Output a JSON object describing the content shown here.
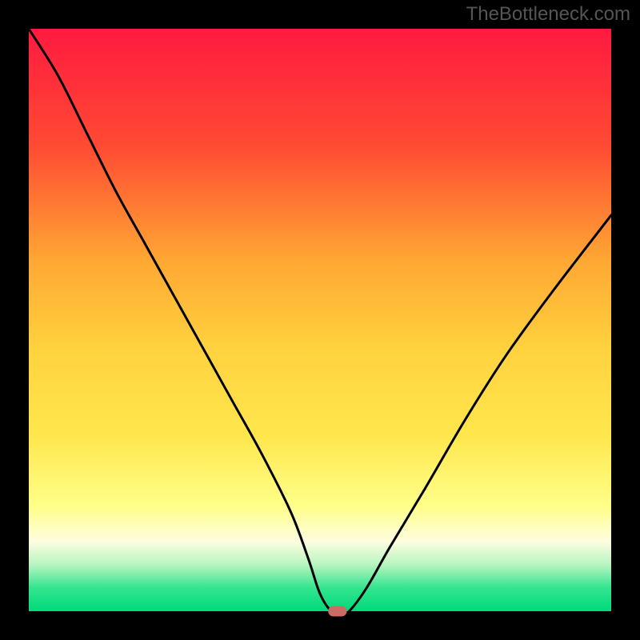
{
  "watermark": "TheBottleneck.com",
  "chart_data": {
    "type": "line",
    "title": "",
    "xlabel": "",
    "ylabel": "",
    "xlim": [
      0,
      100
    ],
    "ylim": [
      0,
      100
    ],
    "grid": false,
    "legend": false,
    "background": {
      "type": "vertical-gradient",
      "stops": [
        {
          "y": 0,
          "color": "#ff1a40"
        },
        {
          "y": 20,
          "color": "#ff4a33"
        },
        {
          "y": 40,
          "color": "#ffa833"
        },
        {
          "y": 55,
          "color": "#ffd23e"
        },
        {
          "y": 70,
          "color": "#ffe74d"
        },
        {
          "y": 82,
          "color": "#ffff8a"
        },
        {
          "y": 88,
          "color": "#fdfde0"
        },
        {
          "y": 92,
          "color": "#b8f5c0"
        },
        {
          "y": 96,
          "color": "#33e58f"
        },
        {
          "y": 100,
          "color": "#00d97a"
        }
      ]
    },
    "curve": {
      "description": "bottleneck percentage curve; 0 at the dip, rising on both sides",
      "x": [
        0,
        5,
        10,
        15,
        20,
        25,
        30,
        35,
        40,
        45,
        48,
        50,
        52,
        54,
        55,
        58,
        62,
        68,
        75,
        82,
        90,
        100
      ],
      "y": [
        100,
        92,
        82,
        72,
        63,
        54,
        45,
        36,
        27,
        17,
        9,
        3,
        0,
        0,
        0,
        4,
        11,
        21,
        33,
        44,
        55,
        68
      ]
    },
    "marker": {
      "x": 53,
      "y": 0,
      "color": "#cc6b64",
      "shape": "rounded-rect",
      "width": 3.2,
      "height": 1.8
    },
    "frame_color": "#000000",
    "frame_width_ratio": 0.045
  }
}
